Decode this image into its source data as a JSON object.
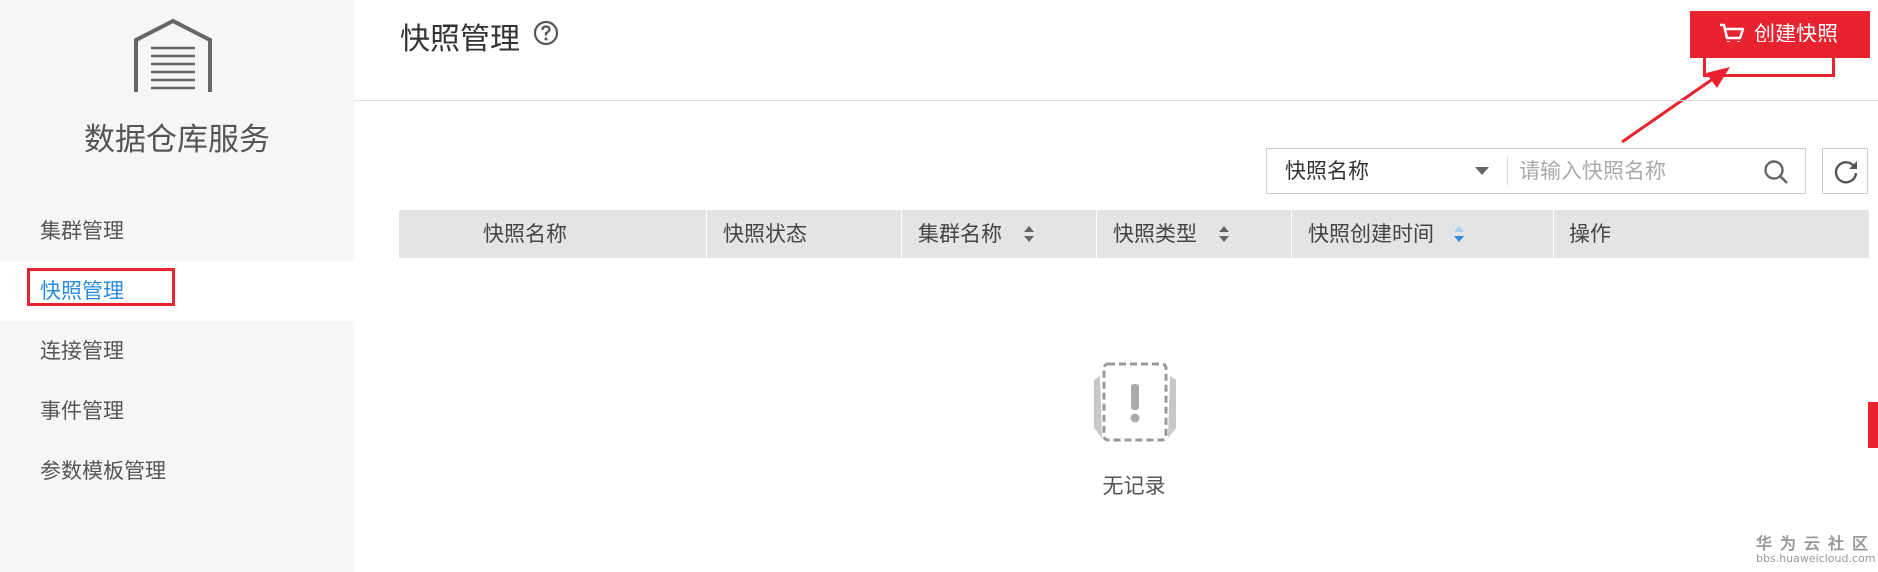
{
  "sidebar": {
    "service_name": "数据仓库服务",
    "items": [
      {
        "label": "集群管理",
        "active": false
      },
      {
        "label": "快照管理",
        "active": true
      },
      {
        "label": "连接管理",
        "active": false
      },
      {
        "label": "事件管理",
        "active": false
      },
      {
        "label": "参数模板管理",
        "active": false
      }
    ]
  },
  "header": {
    "title": "快照管理",
    "create_button_label": "创建快照"
  },
  "filter": {
    "selected_field": "快照名称",
    "search_placeholder": "请输入快照名称"
  },
  "table": {
    "columns": [
      {
        "label": "快照名称",
        "sortable": false
      },
      {
        "label": "快照状态",
        "sortable": false
      },
      {
        "label": "集群名称",
        "sortable": true
      },
      {
        "label": "快照类型",
        "sortable": true
      },
      {
        "label": "快照创建时间",
        "sortable": true,
        "active_sort": true
      },
      {
        "label": "操作",
        "sortable": false
      }
    ],
    "rows": [],
    "empty_text": "无记录"
  },
  "watermark": {
    "title": "华为云社区",
    "url": "bbs.huaweicloud.com"
  },
  "colors": {
    "accent_red": "#e8232f",
    "active_blue": "#2a8ce0",
    "sidebar_bg": "#f5f6f5",
    "table_header_bg": "#e2e4e5"
  }
}
